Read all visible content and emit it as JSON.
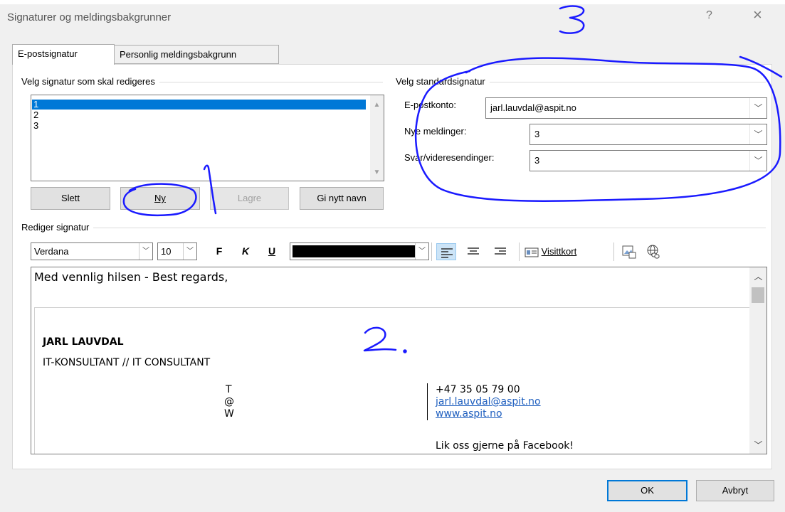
{
  "window": {
    "title": "Signaturer og meldingsbakgrunner",
    "help_label": "?",
    "close_label": "×"
  },
  "tabs": [
    {
      "label": "E-postsignatur",
      "active": true
    },
    {
      "label": "Personlig meldingsbakgrunn",
      "active": false
    }
  ],
  "select_signature": {
    "group_label": "Velg signatur som skal redigeres",
    "items": [
      "1",
      "2",
      "3"
    ],
    "selected_index": 0,
    "buttons": {
      "delete": "Slett",
      "new": "Ny",
      "save": "Lagre",
      "rename": "Gi nytt navn"
    }
  },
  "default_signature": {
    "group_label": "Velg standardsignatur",
    "account_label": "E-postkonto:",
    "account_value": "jarl.lauvdal@aspit.no",
    "new_messages_label": "Nye meldinger:",
    "new_messages_value": "3",
    "replies_label": "Svar/videresendinger:",
    "replies_value": "3"
  },
  "edit_signature": {
    "group_label": "Rediger signatur",
    "font": "Verdana",
    "font_size": "10",
    "bold_label": "F",
    "italic_label": "K",
    "underline_label": "U",
    "font_color": "#000000",
    "business_card_label": "Visittkort"
  },
  "signature_content": {
    "greeting": "Med vennlig hilsen - Best regards,",
    "name": "JARL LAUVDAL",
    "job_title": "IT-KONSULTANT // IT CONSULTANT",
    "contact_labels": [
      "T",
      "@",
      "W"
    ],
    "phone": "+47 35 05 79 00",
    "email": "jarl.lauvdal@aspit.no",
    "website": "www.aspit.no",
    "facebook": "Lik oss gjerne på Facebook!"
  },
  "footer": {
    "ok_label": "OK",
    "cancel_label": "Avbryt"
  },
  "annotations": {
    "color": "#1a1aff",
    "labels": [
      "1",
      "2.",
      "3"
    ]
  }
}
